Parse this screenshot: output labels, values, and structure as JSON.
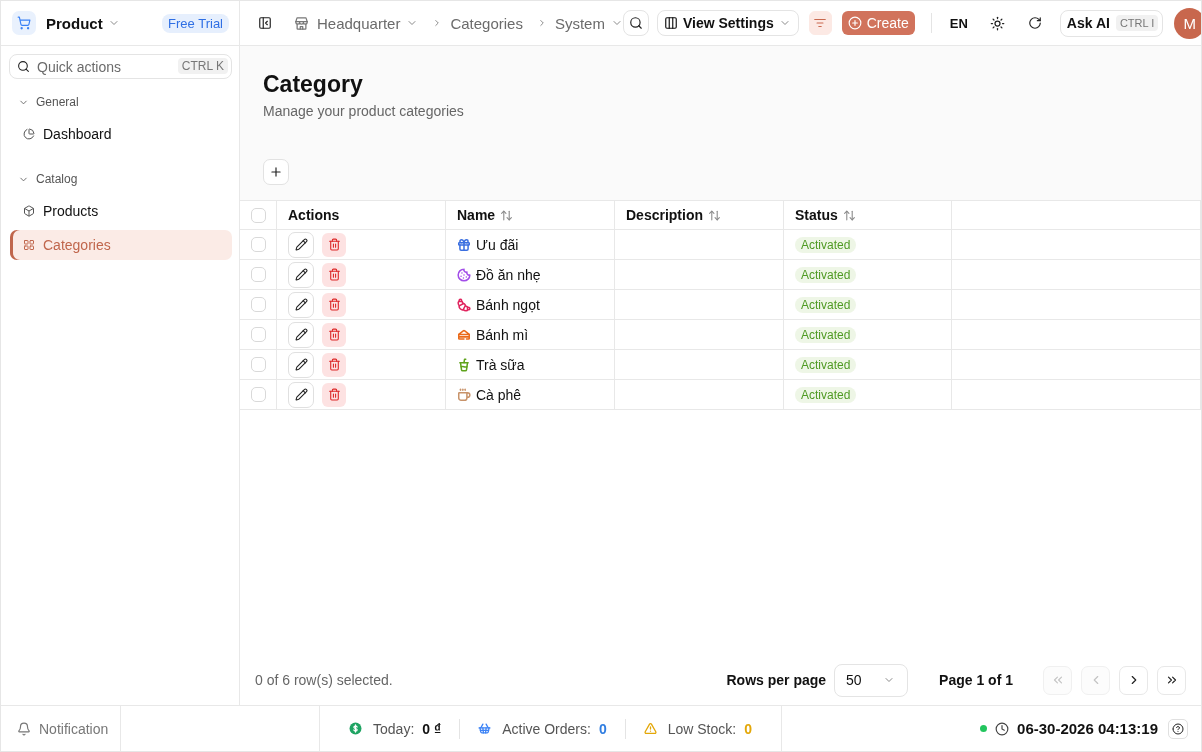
{
  "sidebar": {
    "brand": {
      "name": "Product",
      "badge": "Free Trial"
    },
    "quick_actions": {
      "placeholder": "Quick actions",
      "shortcut": "CTRL K"
    },
    "groups": [
      {
        "label": "General",
        "expanded": true,
        "items": [
          {
            "label": "Dashboard",
            "kind": "pie",
            "selected": false
          }
        ]
      },
      {
        "label": "Catalog",
        "expanded": true,
        "items": [
          {
            "label": "Products",
            "kind": "box",
            "selected": false
          },
          {
            "label": "Categories",
            "kind": "grid",
            "selected": true
          }
        ]
      }
    ]
  },
  "topbar": {
    "workspace": "Headquarter",
    "breadcrumbs": [
      {
        "label": "Categories",
        "has_menu": false
      },
      {
        "label": "System",
        "has_menu": true
      }
    ],
    "view_settings": "View Settings",
    "filter_active": true,
    "create": "Create",
    "language": "EN",
    "ask_ai": {
      "label": "Ask AI",
      "shortcut": "CTRL I"
    },
    "avatar": "M"
  },
  "page": {
    "title": "Category",
    "subtitle": "Manage your product categories"
  },
  "table": {
    "all_checked": false,
    "columns": [
      {
        "label": "Actions",
        "sortable": false
      },
      {
        "label": "Name",
        "sortable": true
      },
      {
        "label": "Description",
        "sortable": true
      },
      {
        "label": "Status",
        "sortable": true
      }
    ],
    "rows": [
      {
        "selected": false,
        "name": "Ưu đãi",
        "kind": "gift",
        "color": "#3b6fe0",
        "status": "Activated"
      },
      {
        "selected": false,
        "name": "Đồ ăn nhẹ",
        "kind": "cookie",
        "color": "#a24de8",
        "status": "Activated"
      },
      {
        "selected": false,
        "name": "Bánh ngọt",
        "kind": "croissant",
        "color": "#e0245e",
        "status": "Activated"
      },
      {
        "selected": false,
        "name": "Bánh mì",
        "kind": "sandwich",
        "color": "#ea6a1a",
        "status": "Activated"
      },
      {
        "selected": false,
        "name": "Trà sữa",
        "kind": "cup",
        "color": "#5fa31c",
        "status": "Activated"
      },
      {
        "selected": false,
        "name": "Cà phê",
        "kind": "mug",
        "color": "#c8936a",
        "status": "Activated"
      }
    ]
  },
  "pagination": {
    "selection": "0 of 6 row(s) selected.",
    "rows_per_page_label": "Rows per page",
    "rows_per_page": "50",
    "page": "Page 1 of 1",
    "buttons": [
      {
        "kind": "first",
        "disabled": true
      },
      {
        "kind": "prev",
        "disabled": true
      },
      {
        "kind": "next",
        "disabled": false
      },
      {
        "kind": "last",
        "disabled": false
      }
    ]
  },
  "footer": {
    "notification": "Notification",
    "stats": [
      {
        "icon": {
          "kind": "dollar",
          "color": "#1fa463"
        },
        "label": "Today:",
        "value": {
          "text": "0 ₫",
          "color": "#111111"
        }
      },
      {
        "icon": {
          "kind": "basket",
          "color": "#3b82f6"
        },
        "label": "Active Orders:",
        "value": {
          "text": "0",
          "color": "#2f7de1"
        }
      },
      {
        "icon": {
          "kind": "warning",
          "color": "#e3a708"
        },
        "label": "Low Stock:",
        "value": {
          "text": "0",
          "color": "#e3a708"
        }
      }
    ],
    "online": true,
    "datetime": "06-30-2026 04:13:19"
  }
}
